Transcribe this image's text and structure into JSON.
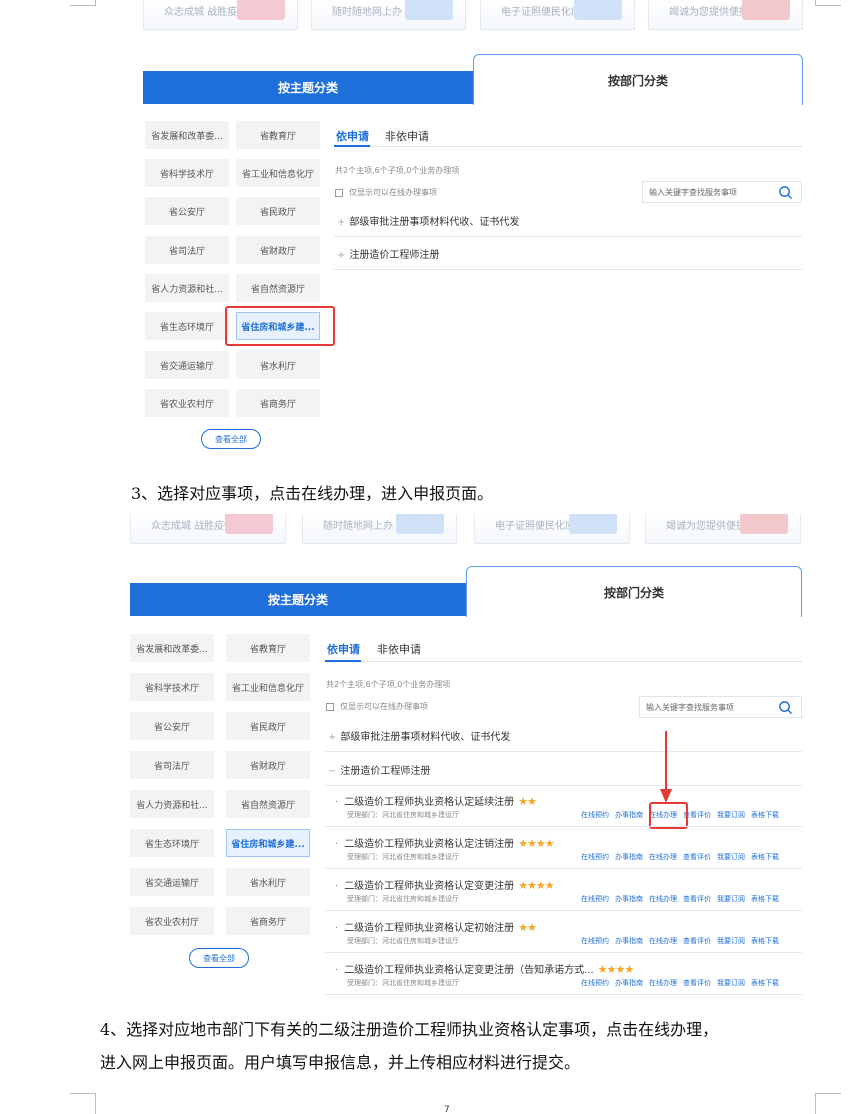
{
  "shot1": {
    "banner_texts": [
      "众志成城 战胜疫情",
      "随时随地网上办",
      "电子证照便民化应用",
      "竭诚为您提供便捷服务"
    ],
    "tab_theme": "按主题分类",
    "tab_dept": "按部门分类",
    "depts": [
      "省发展和改革委...",
      "省教育厅",
      "省科学技术厅",
      "省工业和信息化厅",
      "省公安厅",
      "省民政厅",
      "省司法厅",
      "省财政厅",
      "省人力资源和社...",
      "省自然资源厅",
      "省生态环境厅",
      "省住房和城乡建...",
      "省交通运输厅",
      "省水利厅",
      "省农业农村厅",
      "省商务厅"
    ],
    "view_all": "查看全部",
    "subtab_on": "依申请",
    "subtab_off": "非依申请",
    "count": "共2个主项,6个子项,0个业务办理项",
    "checkbox_label": "仅显示可以在线办理事项",
    "search_placeholder": "输入关键字查找服务事项",
    "categories": [
      "部级审批注册事项材料代收、证书代发",
      "注册造价工程师注册"
    ]
  },
  "para3": "3、选择对应事项，点击在线办理，进入申报页面。",
  "shot2": {
    "banner_texts": [
      "众志成城 战胜疫情",
      "随时随地网上办",
      "电子证照便民化应用",
      "竭诚为您提供便捷服务"
    ],
    "tab_theme": "按主题分类",
    "tab_dept": "按部门分类",
    "depts": [
      "省发展和改革委...",
      "省教育厅",
      "省科学技术厅",
      "省工业和信息化厅",
      "省公安厅",
      "省民政厅",
      "省司法厅",
      "省财政厅",
      "省人力资源和社...",
      "省自然资源厅",
      "省生态环境厅",
      "省住房和城乡建...",
      "省交通运输厅",
      "省水利厅",
      "省农业农村厅",
      "省商务厅"
    ],
    "view_all": "查看全部",
    "subtab_on": "依申请",
    "subtab_off": "非依申请",
    "count": "共2个主项,6个子项,0个业务办理项",
    "checkbox_label": "仅显示可以在线办理事项",
    "search_placeholder": "输入关键字查找服务事项",
    "categories": [
      "部级审批注册事项材料代收、证书代发",
      "注册造价工程师注册"
    ],
    "items": [
      {
        "title": "二级造价工程师执业资格认定延续注册",
        "stars": "★★",
        "dept": "受理部门：河北省住房和城乡建设厅"
      },
      {
        "title": "二级造价工程师执业资格认定注销注册",
        "stars": "★★★★",
        "dept": "受理部门：河北省住房和城乡建设厅"
      },
      {
        "title": "二级造价工程师执业资格认定变更注册",
        "stars": "★★★★",
        "dept": "受理部门：河北省住房和城乡建设厅"
      },
      {
        "title": "二级造价工程师执业资格认定初始注册",
        "stars": "★★",
        "dept": "受理部门：河北省住房和城乡建设厅"
      },
      {
        "title": "二级造价工程师执业资格认定变更注册（告知承诺方式...",
        "stars": "★★★★",
        "dept": "受理部门：河北省住房和城乡建设厅"
      }
    ],
    "actions": [
      "在线预约",
      "办事指南",
      "在线办理",
      "查看评价",
      "我要订阅",
      "表格下载"
    ]
  },
  "para4_line1": "4、选择对应地市部门下有关的二级注册造价工程师执业资格认定事项，点击在线办理，",
  "para4_line2": "进入网上申报页面。用户填写申报信息，并上传相应材料进行提交。",
  "page_number": "7",
  "colors": {
    "accent": "#1e6fd9",
    "highlight": "#e53935",
    "star": "#f5a623"
  }
}
